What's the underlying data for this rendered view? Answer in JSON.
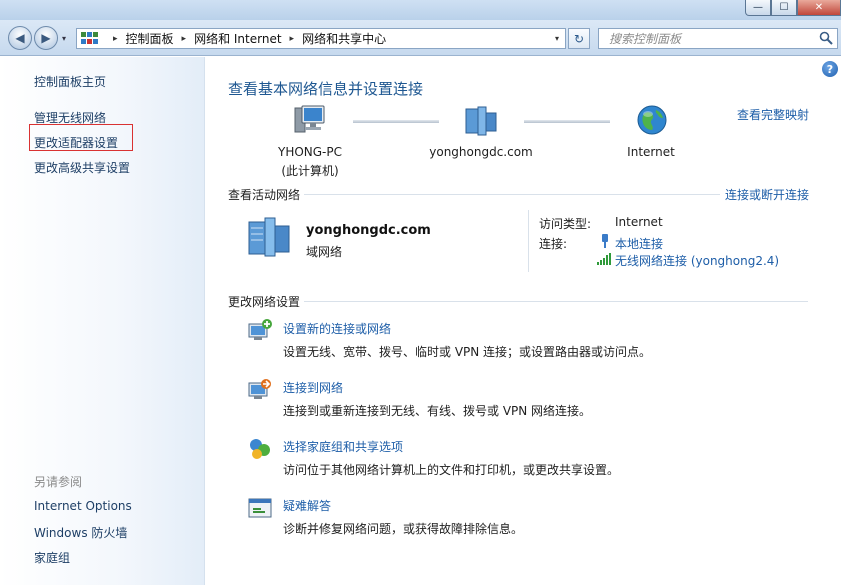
{
  "window": {
    "minimize_glyph": "—",
    "maximize_glyph": "☐",
    "close_glyph": "✕"
  },
  "navigation": {
    "back_glyph": "◀",
    "forward_glyph": "▶",
    "dropdown_glyph": "▾",
    "breadcrumbs": [
      "控制面板",
      "网络和 Internet",
      "网络和共享中心"
    ],
    "separator_glyph": "▸",
    "refresh_glyph": "↻",
    "search_placeholder": "搜索控制面板"
  },
  "sidebar": {
    "home": "控制面板主页",
    "items": [
      {
        "label": "管理无线网络"
      },
      {
        "label": "更改适配器设置",
        "selected": true
      },
      {
        "label": "更改高级共享设置"
      }
    ],
    "see_also_heading": "另请参阅",
    "see_also": [
      {
        "label": "Internet Options"
      },
      {
        "label": "Windows 防火墙"
      },
      {
        "label": "家庭组"
      }
    ]
  },
  "main": {
    "help_glyph": "?",
    "title": "查看基本网络信息并设置连接",
    "full_map_link": "查看完整映射",
    "map_nodes": [
      {
        "label": "YHONG-PC",
        "sublabel": "(此计算机)",
        "icon": "computer-icon"
      },
      {
        "label": "yonghongdc.com",
        "icon": "domain-network-icon"
      },
      {
        "label": "Internet",
        "icon": "globe-icon"
      }
    ],
    "active_networks": {
      "heading": "查看活动网络",
      "connect_link": "连接或断开连接",
      "network_name": "yonghongdc.com",
      "network_type": "域网络",
      "access_type_label": "访问类型:",
      "access_type_value": "Internet",
      "connections_label": "连接:",
      "connections": [
        {
          "label": "本地连接",
          "icon": "ethernet-icon"
        },
        {
          "label": "无线网络连接 (yonghong2.4)",
          "icon": "wifi-signal-icon"
        }
      ]
    },
    "change_settings": {
      "heading": "更改网络设置",
      "tasks": [
        {
          "title": "设置新的连接或网络",
          "desc": "设置无线、宽带、拨号、临时或 VPN 连接；或设置路由器或访问点。",
          "icon": "new-connection-icon"
        },
        {
          "title": "连接到网络",
          "desc": "连接到或重新连接到无线、有线、拨号或 VPN 网络连接。",
          "icon": "connect-network-icon"
        },
        {
          "title": "选择家庭组和共享选项",
          "desc": "访问位于其他网络计算机上的文件和打印机，或更改共享设置。",
          "icon": "homegroup-icon"
        },
        {
          "title": "疑难解答",
          "desc": "诊断并修复网络问题，或获得故障排除信息。",
          "icon": "troubleshoot-icon"
        }
      ]
    }
  },
  "colors": {
    "link": "#1e5ea8",
    "title": "#1e5791",
    "selection_border": "#d93232"
  }
}
